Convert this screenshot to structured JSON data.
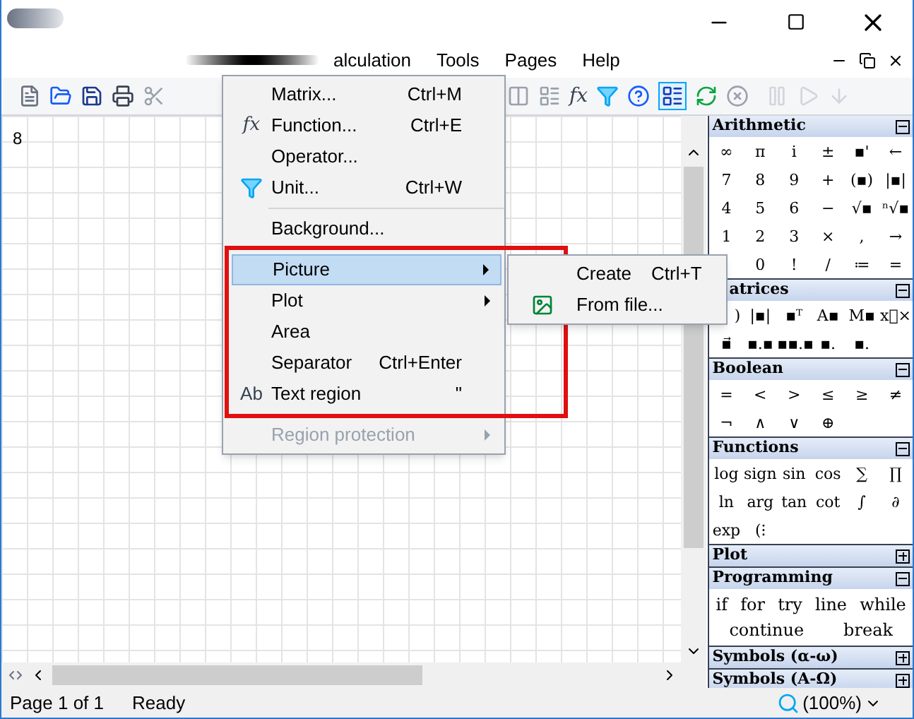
{
  "menu_bar": {
    "items": [
      {
        "label": "alculation",
        "selected": false
      },
      {
        "label": "Tools",
        "selected": false
      },
      {
        "label": "Pages",
        "selected": false
      },
      {
        "label": "Help",
        "selected": false
      }
    ]
  },
  "toolbar": {
    "function_glyph": "fx"
  },
  "canvas": {
    "text": "8"
  },
  "dropdown": {
    "items": [
      {
        "kind": "item",
        "label": "Matrix...",
        "shortcut": "Ctrl+M",
        "selected": false
      },
      {
        "kind": "item",
        "label": "Function...",
        "shortcut": "Ctrl+E",
        "glyph": "fx",
        "selected": false
      },
      {
        "kind": "item",
        "label": "Operator...",
        "selected": false
      },
      {
        "kind": "item",
        "label": "Unit...",
        "shortcut": "Ctrl+W",
        "selected": false
      },
      {
        "kind": "separator"
      },
      {
        "kind": "item",
        "label": "Background...",
        "selected": false
      },
      {
        "kind": "separator"
      },
      {
        "kind": "submenu",
        "label": "Picture",
        "selected": true
      },
      {
        "kind": "submenu",
        "label": "Plot",
        "selected": false
      },
      {
        "kind": "item",
        "label": "Area",
        "selected": false
      },
      {
        "kind": "item",
        "label": "Separator",
        "shortcut": "Ctrl+Enter",
        "selected": false
      },
      {
        "kind": "item",
        "label": "Text region",
        "shortcut": "\"",
        "glyph": "Ab",
        "selected": false
      },
      {
        "kind": "separator"
      },
      {
        "kind": "submenu",
        "label": "Region protection",
        "selected": false,
        "disabled": true
      }
    ]
  },
  "submenu": {
    "items": [
      {
        "label": "Create",
        "shortcut": "Ctrl+T"
      },
      {
        "label": "From file..."
      }
    ]
  },
  "palette": [
    {
      "title": "Arithmetic",
      "expanded": true,
      "rows": [
        {
          "cells": [
            "∞",
            "π",
            "i",
            "±",
            "▪'",
            "←"
          ]
        },
        {
          "cells": [
            "7",
            "8",
            "9",
            "+",
            "(▪)",
            "|▪|"
          ]
        },
        {
          "cells": [
            "4",
            "5",
            "6",
            "−",
            "√▪",
            "ⁿ√▪"
          ]
        },
        {
          "cells": [
            "1",
            "2",
            "3",
            "×",
            ",",
            "→"
          ]
        },
        {
          "cells": [
            "",
            "0",
            "!",
            "/",
            "≔",
            "="
          ]
        }
      ]
    },
    {
      "title": "atrices",
      "expanded": true,
      "rows": [
        {
          "cells": [
            ")",
            "|▪|",
            "▪ᵀ",
            "A▪",
            "M▪",
            "x⃗×"
          ]
        },
        {
          "cells": [
            "▪⃗",
            "▪.▪",
            "▪▪.▪",
            "▪.",
            "▪."
          ]
        }
      ]
    },
    {
      "title": "Boolean",
      "expanded": true,
      "rows": [
        {
          "cells": [
            "=",
            "<",
            ">",
            "≤",
            "≥",
            "≠"
          ]
        },
        {
          "cells": [
            "¬",
            "∧",
            "∨",
            "⊕"
          ]
        }
      ]
    },
    {
      "title": "Functions",
      "expanded": true,
      "rows": [
        {
          "cells": [
            "log",
            "sign",
            "sin",
            "cos",
            "∑",
            "∏"
          ]
        },
        {
          "cells": [
            "ln",
            "arg",
            "tan",
            "cot",
            "∫",
            "∂"
          ]
        },
        {
          "cells": [
            "exp",
            "(⁝"
          ]
        }
      ]
    },
    {
      "title": "Plot",
      "expanded": false
    },
    {
      "title": "Programming",
      "expanded": true,
      "keywords": [
        "if",
        "for",
        "try",
        "line",
        "while",
        "continue",
        "break"
      ]
    },
    {
      "title": "Symbols (α-ω)",
      "expanded": false
    },
    {
      "title": "Symbols (Α-Ω)",
      "expanded": false
    }
  ],
  "status_bar": {
    "page": "Page 1 of 1",
    "state": "Ready",
    "zoom": "(100%)"
  }
}
